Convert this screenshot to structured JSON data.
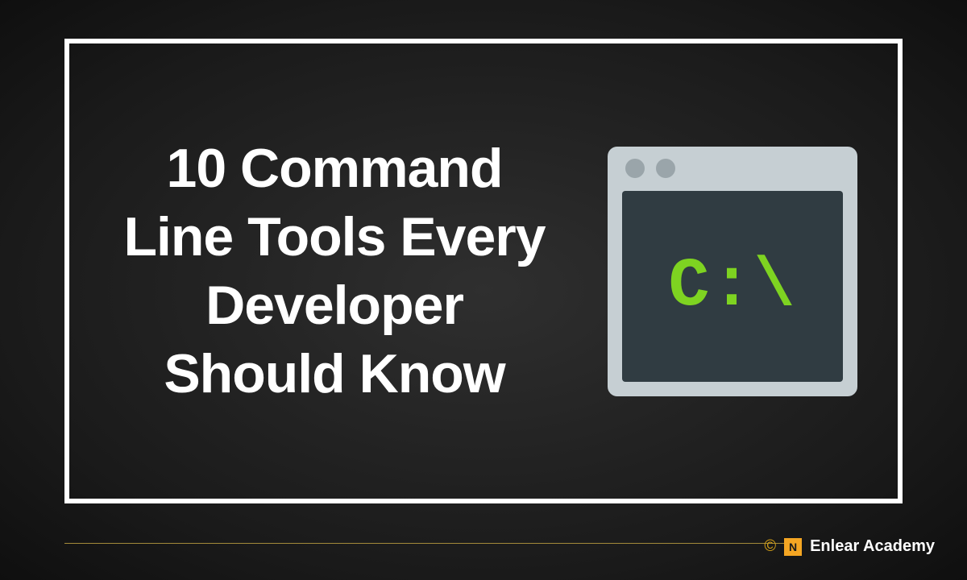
{
  "title": "10 Command Line Tools Every Developer Should Know",
  "terminal": {
    "prompt": "C:\\"
  },
  "footer": {
    "copyright": "©",
    "logo_letter": "N",
    "brand": "Enlear Academy"
  }
}
